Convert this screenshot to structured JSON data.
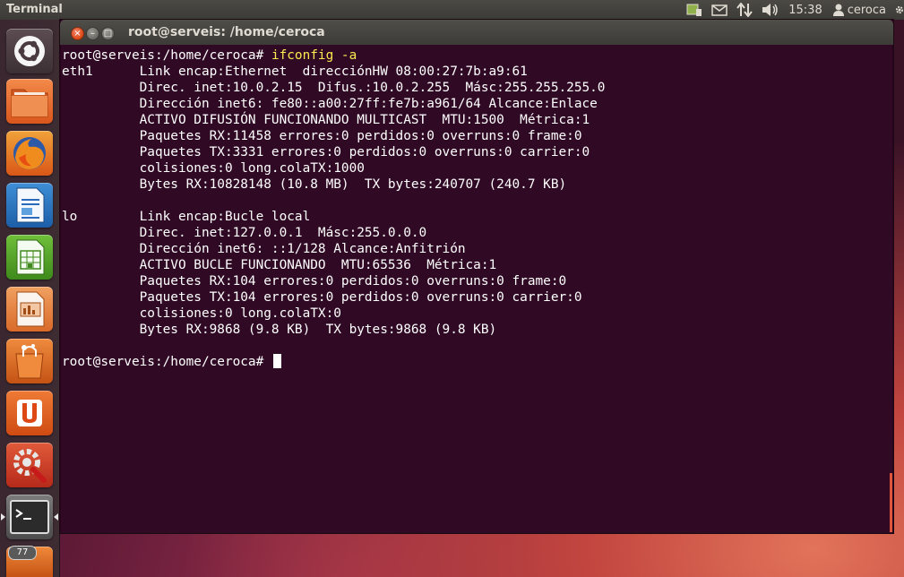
{
  "top_panel": {
    "app_name": "Terminal",
    "time": "15:38",
    "user": "ceroca",
    "indicators": [
      "network-manager-icon",
      "mail-icon",
      "transfer-arrows-icon",
      "volume-icon",
      "user-icon",
      "gear-icon"
    ]
  },
  "launcher": {
    "items": [
      {
        "name": "dash-home",
        "icon": "ubuntu-logo-icon"
      },
      {
        "name": "home-folder",
        "icon": "folder-icon"
      },
      {
        "name": "firefox",
        "icon": "firefox-icon"
      },
      {
        "name": "libreoffice-writer",
        "icon": "writer-icon"
      },
      {
        "name": "libreoffice-calc",
        "icon": "calc-icon"
      },
      {
        "name": "libreoffice-impress",
        "icon": "impress-icon"
      },
      {
        "name": "software-center",
        "icon": "shopping-bag-icon"
      },
      {
        "name": "ubuntu-one",
        "icon": "ubuntu-one-icon"
      },
      {
        "name": "system-settings",
        "icon": "settings-wrench-icon"
      },
      {
        "name": "terminal",
        "icon": "terminal-icon"
      }
    ],
    "updates_badge": "77"
  },
  "window": {
    "title": "root@serveis: /home/ceroca",
    "prompt": "root@serveis:/home/ceroca# ",
    "command": "ifconfig -a",
    "output": "eth1      Link encap:Ethernet  direcciónHW 08:00:27:7b:a9:61  \n          Direc. inet:10.0.2.15  Difus.:10.0.2.255  Másc:255.255.255.0\n          Dirección inet6: fe80::a00:27ff:fe7b:a961/64 Alcance:Enlace\n          ACTIVO DIFUSIÓN FUNCIONANDO MULTICAST  MTU:1500  Métrica:1\n          Paquetes RX:11458 errores:0 perdidos:0 overruns:0 frame:0\n          Paquetes TX:3331 errores:0 perdidos:0 overruns:0 carrier:0\n          colisiones:0 long.colaTX:1000 \n          Bytes RX:10828148 (10.8 MB)  TX bytes:240707 (240.7 KB)\n\nlo        Link encap:Bucle local  \n          Direc. inet:127.0.0.1  Másc:255.0.0.0\n          Dirección inet6: ::1/128 Alcance:Anfitrión\n          ACTIVO BUCLE FUNCIONANDO  MTU:65536  Métrica:1\n          Paquetes RX:104 errores:0 perdidos:0 overruns:0 frame:0\n          Paquetes TX:104 errores:0 perdidos:0 overruns:0 carrier:0\n          colisiones:0 long.colaTX:0 \n          Bytes RX:9868 (9.8 KB)  TX bytes:9868 (9.8 KB)\n\n",
    "final_prompt": "root@serveis:/home/ceroca# "
  },
  "colors": {
    "terminal_bg": "#300a24",
    "command_text": "#fce94f",
    "panel_bg": "#3c3b37",
    "close_button": "#dd4814"
  }
}
